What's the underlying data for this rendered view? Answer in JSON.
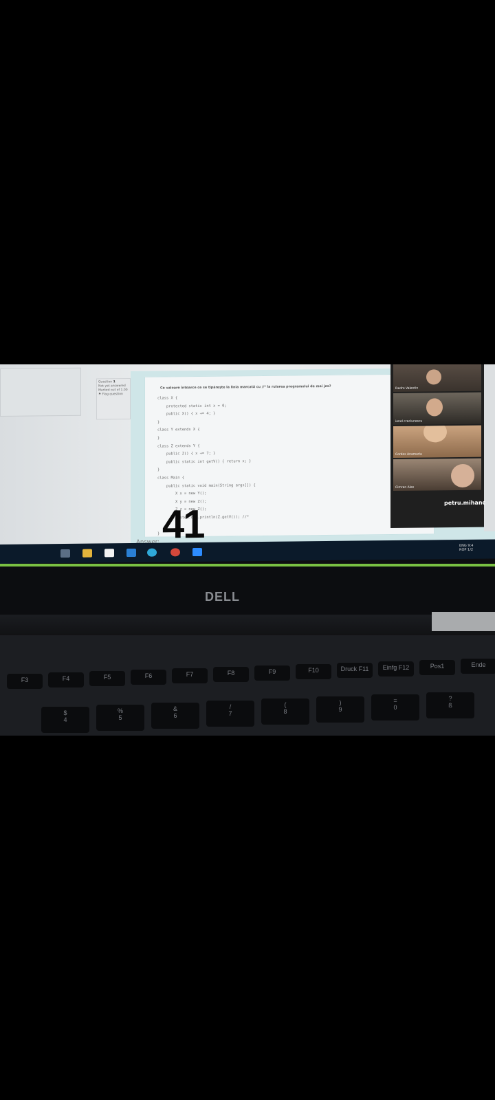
{
  "screen": {
    "question_label": "Question",
    "question_number": "1",
    "status_text": "Not yet answered",
    "marked_text": "Marked out of 1.00",
    "flag_label": "Flag question",
    "question_prompt": "Ce valoare întoarce ce se tipărește la linia marcată cu //* la rularea programului de mai jos?",
    "code_lines": [
      "class X {",
      "    protected static int x = 0;",
      "    public X() { x += 4; }",
      "}",
      "class Y extends X {",
      "}",
      "class Z extends Y {",
      "    public Z() { x += 7; }",
      "    public static int getV() { return x; }",
      "}",
      "class Main {",
      "    public static void main(String args[]) {",
      "        X x = new Y();",
      "        X y = new Z();",
      "        Z z = new Z();",
      "        System.out.println(Z.getV()); //*",
      "    }",
      "}"
    ],
    "overlay_answer": "41",
    "answer_label": "Answer:"
  },
  "video_call": {
    "participants": [
      "Dedro Valentin",
      "ionel craciunescu",
      "Cordos Anamaria",
      "Cimran Alex"
    ],
    "presenter": "petru.mihanc"
  },
  "taskbar": {
    "tray_lang_top": "ENG",
    "tray_lang_bottom": "ROP",
    "tray_time": "9:4",
    "tray_date": "1/2"
  },
  "laptop": {
    "brand": "DELL"
  },
  "keyboard": {
    "row1": [
      "F3",
      "F4",
      "F5",
      "F6",
      "F7",
      "F8",
      "F9",
      "F10",
      "Druck F11",
      "Einfg F12",
      "Pos1",
      "Ende"
    ],
    "row2": [
      "$",
      "%",
      "&",
      "/",
      "(",
      ")",
      "=",
      "?"
    ],
    "row2_sub": [
      "4",
      "5",
      "6",
      "7",
      "8",
      "9",
      "0",
      "ß"
    ]
  },
  "colors": {
    "taskbar": "#0b1a2a",
    "accent_green": "#7ac143",
    "content_border": "#c8e2e4"
  }
}
